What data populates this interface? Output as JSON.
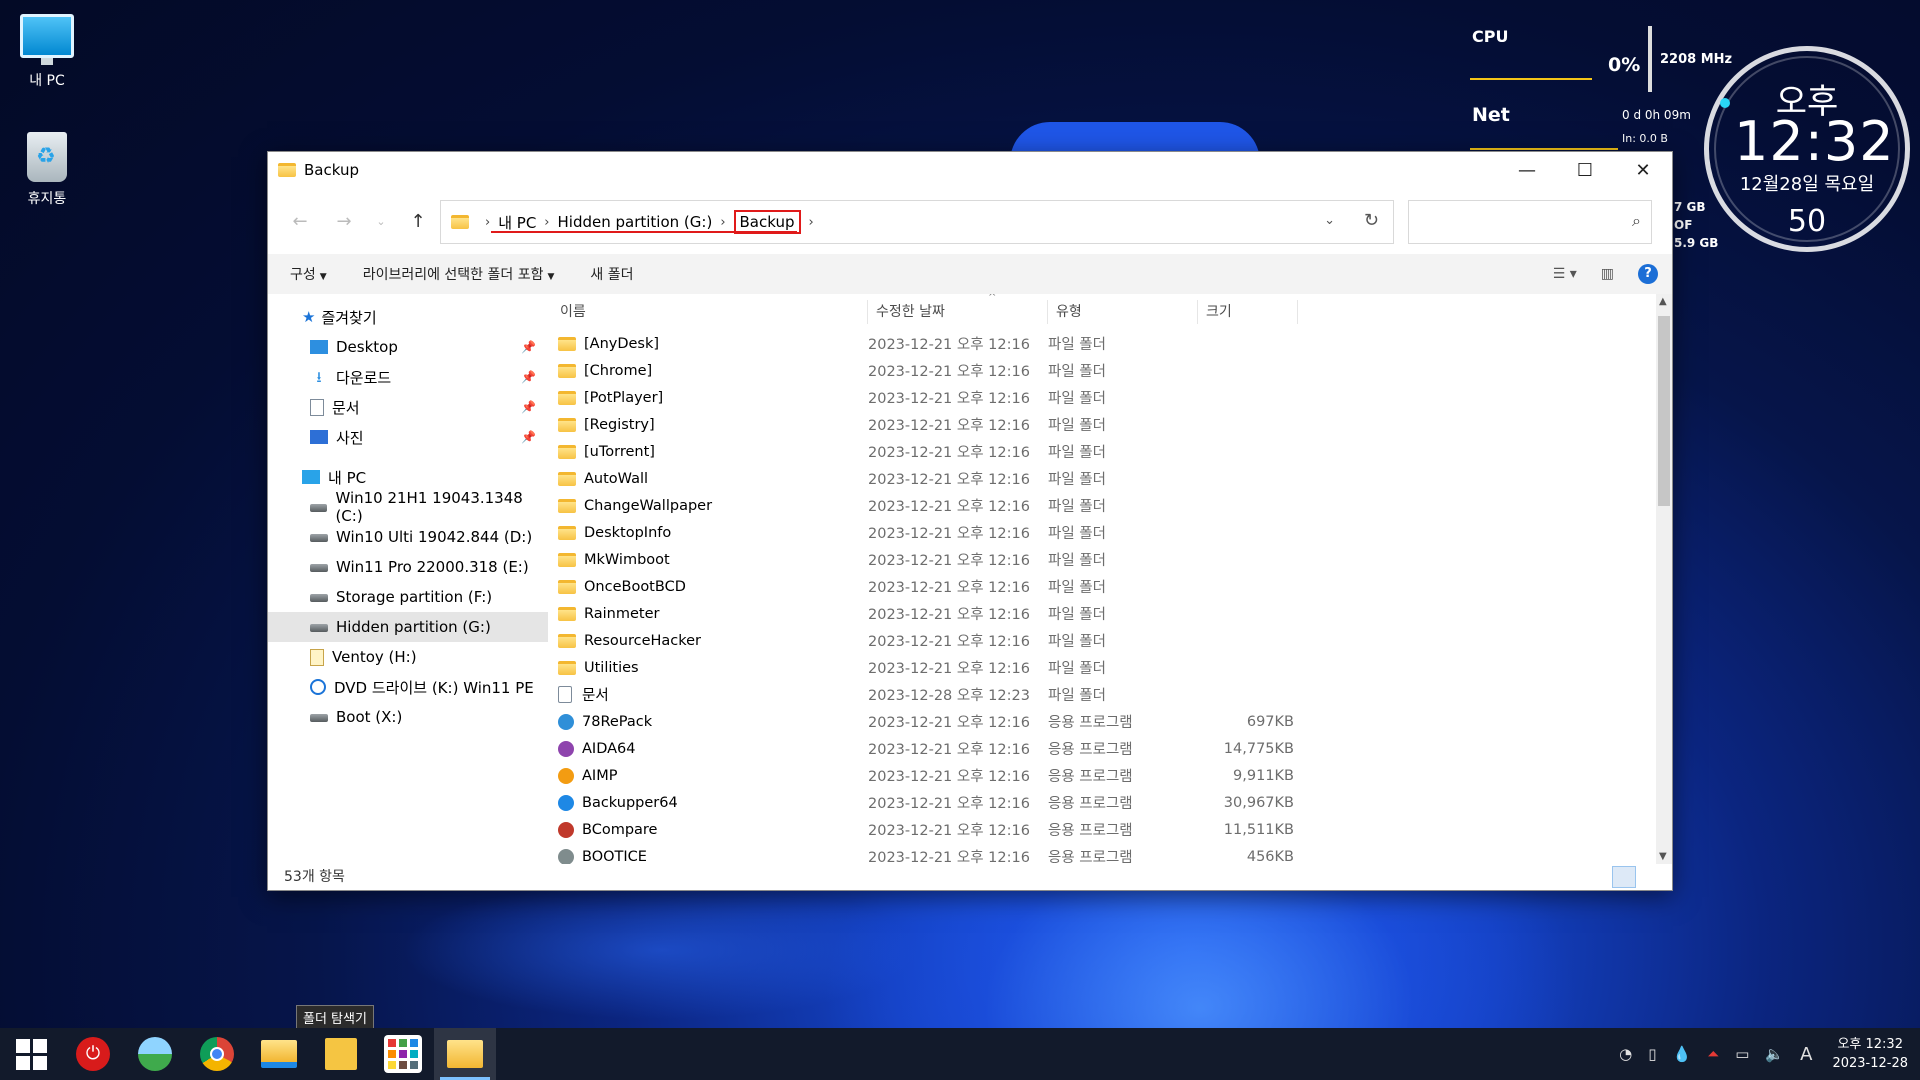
{
  "desktop": {
    "icons": [
      {
        "label": "내 PC",
        "icon": "computer-icon"
      },
      {
        "label": "휴지통",
        "icon": "recycle-bin-icon"
      }
    ]
  },
  "widgets": {
    "cpu_label": "CPU",
    "cpu_percent": "0%",
    "cpu_freq": "2208 MHz",
    "net_label": "Net",
    "uptime": "0 d 0h 09m",
    "net_in": "In: 0.0 B",
    "disk_line1": "7 GB",
    "disk_line2": "OF",
    "disk_line3": "5.9 GB",
    "clock_ampm": "오후",
    "clock_time": "12:32",
    "clock_date": "12월28일 목요일",
    "clock_seconds": "50"
  },
  "window": {
    "title": "Backup",
    "breadcrumb": [
      "내 PC",
      "Hidden partition (G:)",
      "Backup"
    ],
    "search_placeholder": "",
    "commands": [
      "구성",
      "라이브러리에 선택한 폴더 포함",
      "새 폴더"
    ],
    "status": "53개 항목"
  },
  "navpane": {
    "quick_access_label": "즐겨찾기",
    "quick_access": [
      {
        "label": "Desktop",
        "icon": "desktop-icon"
      },
      {
        "label": "다운로드",
        "icon": "download-icon"
      },
      {
        "label": "문서",
        "icon": "documents-icon"
      },
      {
        "label": "사진",
        "icon": "pictures-icon"
      }
    ],
    "this_pc_label": "내 PC",
    "drives": [
      {
        "label": "Win10 21H1 19043.1348 (C:)",
        "icon": "system-drive-icon"
      },
      {
        "label": "Win10 Ulti 19042.844 (D:)",
        "icon": "drive-icon"
      },
      {
        "label": "Win11 Pro 22000.318 (E:)",
        "icon": "drive-icon"
      },
      {
        "label": "Storage partition (F:)",
        "icon": "drive-icon"
      },
      {
        "label": "Hidden partition (G:)",
        "icon": "drive-icon"
      },
      {
        "label": "Ventoy (H:)",
        "icon": "usb-drive-icon"
      },
      {
        "label": "DVD 드라이브 (K:) Win11 PE",
        "icon": "dvd-drive-icon"
      },
      {
        "label": "Boot (X:)",
        "icon": "boot-drive-icon"
      }
    ]
  },
  "columns": [
    "이름",
    "수정한 날짜",
    "유형",
    "크기"
  ],
  "files": [
    {
      "name": "[AnyDesk]",
      "date": "2023-12-21 오후 12:16",
      "type": "파일 폴더",
      "size": "",
      "kind": "folder"
    },
    {
      "name": "[Chrome]",
      "date": "2023-12-21 오후 12:16",
      "type": "파일 폴더",
      "size": "",
      "kind": "folder"
    },
    {
      "name": "[PotPlayer]",
      "date": "2023-12-21 오후 12:16",
      "type": "파일 폴더",
      "size": "",
      "kind": "folder"
    },
    {
      "name": "[Registry]",
      "date": "2023-12-21 오후 12:16",
      "type": "파일 폴더",
      "size": "",
      "kind": "folder"
    },
    {
      "name": "[uTorrent]",
      "date": "2023-12-21 오후 12:16",
      "type": "파일 폴더",
      "size": "",
      "kind": "folder"
    },
    {
      "name": "AutoWall",
      "date": "2023-12-21 오후 12:16",
      "type": "파일 폴더",
      "size": "",
      "kind": "folder"
    },
    {
      "name": "ChangeWallpaper",
      "date": "2023-12-21 오후 12:16",
      "type": "파일 폴더",
      "size": "",
      "kind": "folder"
    },
    {
      "name": "DesktopInfo",
      "date": "2023-12-21 오후 12:16",
      "type": "파일 폴더",
      "size": "",
      "kind": "folder"
    },
    {
      "name": "MkWimboot",
      "date": "2023-12-21 오후 12:16",
      "type": "파일 폴더",
      "size": "",
      "kind": "folder"
    },
    {
      "name": "OnceBootBCD",
      "date": "2023-12-21 오후 12:16",
      "type": "파일 폴더",
      "size": "",
      "kind": "folder"
    },
    {
      "name": "Rainmeter",
      "date": "2023-12-21 오후 12:16",
      "type": "파일 폴더",
      "size": "",
      "kind": "folder"
    },
    {
      "name": "ResourceHacker",
      "date": "2023-12-21 오후 12:16",
      "type": "파일 폴더",
      "size": "",
      "kind": "folder"
    },
    {
      "name": "Utilities",
      "date": "2023-12-21 오후 12:16",
      "type": "파일 폴더",
      "size": "",
      "kind": "folder"
    },
    {
      "name": "문서",
      "date": "2023-12-28 오후 12:23",
      "type": "파일 폴더",
      "size": "",
      "kind": "doc"
    },
    {
      "name": "78RePack",
      "date": "2023-12-21 오후 12:16",
      "type": "응용 프로그램",
      "size": "697KB",
      "kind": "app",
      "color": "#2f8fd8"
    },
    {
      "name": "AIDA64",
      "date": "2023-12-21 오후 12:16",
      "type": "응용 프로그램",
      "size": "14,775KB",
      "kind": "app",
      "color": "#8e44ad"
    },
    {
      "name": "AIMP",
      "date": "2023-12-21 오후 12:16",
      "type": "응용 프로그램",
      "size": "9,911KB",
      "kind": "app",
      "color": "#f39c12"
    },
    {
      "name": "Backupper64",
      "date": "2023-12-21 오후 12:16",
      "type": "응용 프로그램",
      "size": "30,967KB",
      "kind": "app",
      "color": "#1e88e5"
    },
    {
      "name": "BCompare",
      "date": "2023-12-21 오후 12:16",
      "type": "응용 프로그램",
      "size": "11,511KB",
      "kind": "app",
      "color": "#c0392b"
    },
    {
      "name": "BOOTICE",
      "date": "2023-12-21 오후 12:16",
      "type": "응용 프로그램",
      "size": "456KB",
      "kind": "app",
      "color": "#7f8c8d"
    }
  ],
  "taskbar": {
    "tooltip": "폴더 탐색기",
    "items": [
      "start-icon",
      "power-icon",
      "photos-icon",
      "chrome-icon",
      "file-explorer-icon",
      "folder-explorer-tool-icon",
      "apps-grid-icon",
      "explorer-window-icon"
    ],
    "clock_time": "오후 12:32",
    "clock_date": "2023-12-28",
    "ime": "A"
  }
}
